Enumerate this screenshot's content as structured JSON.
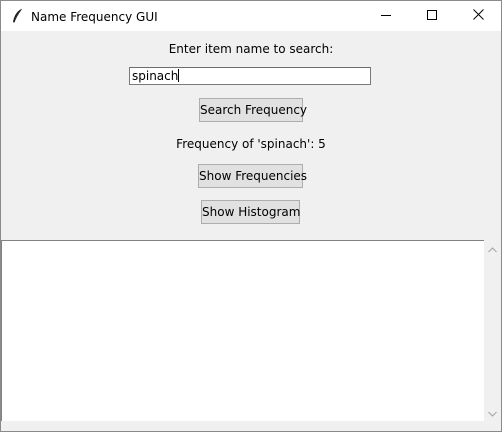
{
  "window": {
    "title": "Name Frequency GUI"
  },
  "form": {
    "prompt": "Enter item name to search:",
    "search_value": "spinach",
    "search_button": "Search Frequency",
    "result_text": "Frequency of 'spinach': 5",
    "show_frequencies_button": "Show Frequencies",
    "show_histogram_button": "Show Histogram"
  },
  "output": {
    "text": ""
  },
  "icons": {
    "app": "feather-icon",
    "minimize": "minimize-icon",
    "maximize": "maximize-icon",
    "close": "close-icon",
    "scroll_up": "chevron-up-icon",
    "scroll_down": "chevron-down-icon"
  },
  "colors": {
    "window_bg": "#f0f0f0",
    "titlebar_bg": "#ffffff",
    "button_bg": "#e1e1e1",
    "button_border": "#adadad"
  }
}
